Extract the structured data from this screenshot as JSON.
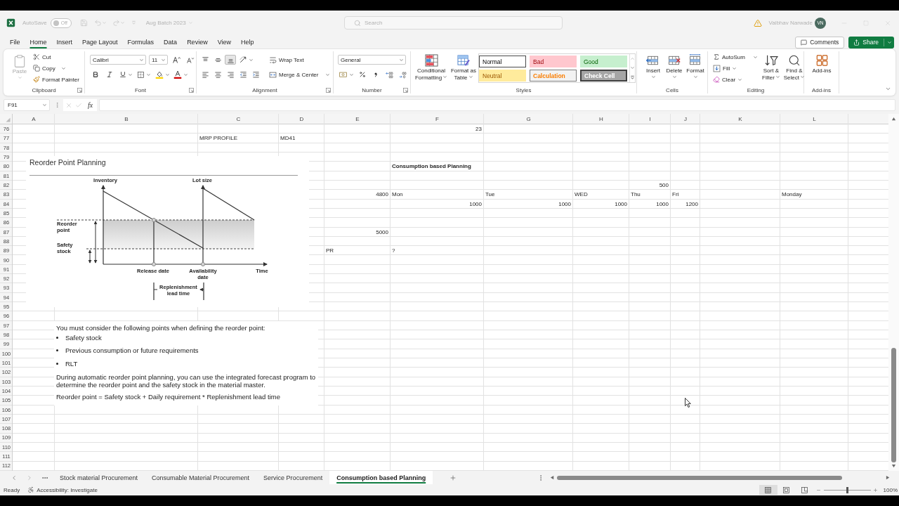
{
  "title_bar": {
    "autosave": {
      "label": "AutoSave",
      "on": false,
      "state": "Off"
    },
    "document": "Aug Batch 2023",
    "search": {
      "placeholder": "Search"
    },
    "user": {
      "name": "Vaibhav Narwade",
      "initials": "VN"
    }
  },
  "menu": {
    "tabs": [
      {
        "label": "File",
        "selected": false
      },
      {
        "label": "Home",
        "selected": true
      },
      {
        "label": "Insert",
        "selected": false
      },
      {
        "label": "Page Layout",
        "selected": false
      },
      {
        "label": "Formulas",
        "selected": false
      },
      {
        "label": "Data",
        "selected": false
      },
      {
        "label": "Review",
        "selected": false
      },
      {
        "label": "View",
        "selected": false
      },
      {
        "label": "Help",
        "selected": false
      }
    ],
    "comments": "Comments",
    "share": "Share"
  },
  "ribbon": [
    {
      "kind": "clipboard",
      "label": "Clipboard",
      "paste": {
        "label": "Paste",
        "disabled": true
      },
      "cut": "Cut",
      "copy": "Copy",
      "format_painter": "Format Painter"
    },
    {
      "kind": "font",
      "label": "Font",
      "font_name": "Calibri",
      "font_size": "11"
    },
    {
      "kind": "alignment",
      "label": "Alignment",
      "vertical_align": [
        {
          "kind": "top",
          "selected": false
        },
        {
          "kind": "middle",
          "selected": false
        },
        {
          "kind": "bottom",
          "selected": true
        }
      ],
      "wrap_text": "Wrap Text",
      "merge_center": "Merge & Center"
    },
    {
      "kind": "number",
      "label": "Number",
      "format": "General"
    },
    {
      "kind": "styles",
      "label": "Styles",
      "conditional_formatting": "Conditional Formatting",
      "format_as_table": "Format as Table",
      "cell_styles": [
        {
          "label": "Normal",
          "kind": "normal"
        },
        {
          "label": "Bad",
          "kind": "bad"
        },
        {
          "label": "Good",
          "kind": "good"
        },
        {
          "label": "Neutral",
          "kind": "neutral"
        },
        {
          "label": "Calculation",
          "kind": "calculation"
        },
        {
          "label": "Check Cell",
          "kind": "check"
        }
      ]
    },
    {
      "kind": "cells",
      "label": "Cells",
      "buttons": [
        {
          "label": "Insert",
          "kind": "insert"
        },
        {
          "label": "Delete",
          "kind": "delete"
        },
        {
          "label": "Format",
          "kind": "format"
        }
      ]
    },
    {
      "kind": "editing",
      "label": "Editing",
      "autosum": "AutoSum",
      "fill": "Fill",
      "clear": "Clear",
      "sort_filter": "Sort & Filter",
      "find_select": "Find & Select"
    },
    {
      "kind": "addins",
      "label": "Add-ins",
      "button": "Add-ins"
    }
  ],
  "formula_bar": {
    "name_box": "F91",
    "function_button": "fx"
  },
  "sheet": {
    "columns": [
      {
        "label": "A"
      },
      {
        "label": "B"
      },
      {
        "label": "C"
      },
      {
        "label": "D"
      },
      {
        "label": "E"
      },
      {
        "label": "F"
      },
      {
        "label": "G"
      },
      {
        "label": "H"
      },
      {
        "label": "I"
      },
      {
        "label": "J"
      },
      {
        "label": "K"
      },
      {
        "label": "L"
      }
    ],
    "rows": [
      {
        "number": "76",
        "cells": {
          "F": {
            "text": "23",
            "kind": "number"
          }
        }
      },
      {
        "number": "77",
        "cells": {
          "C": {
            "text": "MRP PROFILE",
            "kind": "text"
          },
          "D": {
            "text": "MD41",
            "kind": "text"
          }
        }
      },
      {
        "number": "78"
      },
      {
        "number": "79"
      },
      {
        "number": "80",
        "cells": {
          "F": {
            "text": "Consumption based Planning",
            "kind": "text",
            "bold": true
          }
        }
      },
      {
        "number": "81"
      },
      {
        "number": "82",
        "cells": {
          "I": {
            "text": "500",
            "kind": "number"
          }
        }
      },
      {
        "number": "83",
        "cells": {
          "E": {
            "text": "4800",
            "kind": "number"
          },
          "F": {
            "text": "Mon",
            "kind": "text"
          },
          "G": {
            "text": "Tue",
            "kind": "text"
          },
          "H": {
            "text": "WED",
            "kind": "text"
          },
          "I": {
            "text": "Thu",
            "kind": "text"
          },
          "J": {
            "text": "Fri",
            "kind": "text"
          },
          "L": {
            "text": "Monday",
            "kind": "text"
          }
        }
      },
      {
        "number": "84",
        "cells": {
          "F": {
            "text": "1000",
            "kind": "number"
          },
          "G": {
            "text": "1000",
            "kind": "number"
          },
          "H": {
            "text": "1000",
            "kind": "number"
          },
          "I": {
            "text": "1000",
            "kind": "number"
          },
          "J": {
            "text": "1200",
            "kind": "number"
          }
        }
      },
      {
        "number": "85"
      },
      {
        "number": "86"
      },
      {
        "number": "87",
        "cells": {
          "E": {
            "text": "5000",
            "kind": "number"
          }
        }
      },
      {
        "number": "88"
      },
      {
        "number": "89",
        "cells": {
          "E": {
            "text": "PR",
            "kind": "text"
          },
          "F": {
            "text": "?",
            "kind": "text"
          }
        }
      },
      {
        "number": "90"
      },
      {
        "number": "91"
      },
      {
        "number": "92"
      },
      {
        "number": "93"
      },
      {
        "number": "94"
      },
      {
        "number": "95"
      },
      {
        "number": "96"
      },
      {
        "number": "97"
      },
      {
        "number": "98"
      },
      {
        "number": "99"
      },
      {
        "number": "100"
      },
      {
        "number": "101"
      },
      {
        "number": "102"
      },
      {
        "number": "103"
      },
      {
        "number": "104"
      },
      {
        "number": "105"
      },
      {
        "number": "106"
      },
      {
        "number": "107"
      },
      {
        "number": "108"
      },
      {
        "number": "109"
      },
      {
        "number": "110"
      },
      {
        "number": "111"
      },
      {
        "number": "112"
      }
    ],
    "diagram": {
      "title": "Reorder Point Planning",
      "y_axis": "Inventory",
      "lot_size": "Lot size",
      "reorder_point": "Reorder point",
      "safety_stock": "Safety stock",
      "release_date": "Release date",
      "availability_date": "Availability date",
      "x_axis": "Time",
      "lead_time": "Replenishment lead time"
    },
    "notes": {
      "intro": "You must consider the following points when defining the reorder point:",
      "points": [
        "Safety stock",
        "Previous consumption or future requirements",
        "RLT"
      ],
      "paragraph": "During automatic reorder point planning, you can use the integrated forecast program to determine the reorder point and the safety stock in the material master.",
      "formula": "Reorder point = Safety stock + Daily requirement * Replenishment lead time"
    }
  },
  "sheet_tabs": [
    {
      "label": "Stock material Procurement",
      "selected": false
    },
    {
      "label": "Consumable Material Procurement",
      "selected": false
    },
    {
      "label": "Service Procurement",
      "selected": false
    },
    {
      "label": "Consumption based Planning",
      "selected": true
    }
  ],
  "status_bar": {
    "status": "Ready",
    "accessibility": "Accessibility: Investigate",
    "views": [
      {
        "kind": "normal",
        "selected": true
      },
      {
        "kind": "page_layout",
        "selected": false
      },
      {
        "kind": "page_break",
        "selected": false
      }
    ],
    "zoom": {
      "level": 0.5,
      "reading": "100%"
    }
  }
}
